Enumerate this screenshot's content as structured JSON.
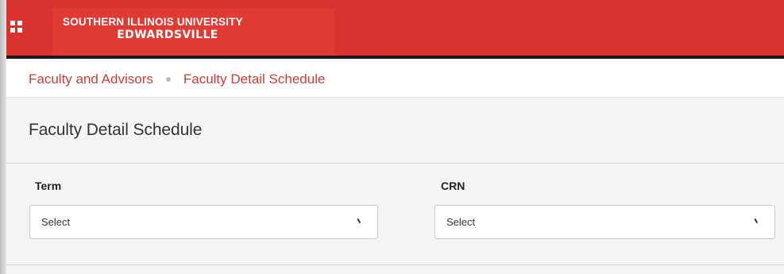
{
  "header": {
    "brand_line1": "SOUTHERN ILLINOIS UNIVERSITY",
    "brand_line2": "EDWARDSVILLE",
    "color": "#d9322f"
  },
  "breadcrumb": {
    "items": [
      "Faculty and Advisors",
      "Faculty Detail Schedule"
    ]
  },
  "page": {
    "title": "Faculty Detail Schedule"
  },
  "filters": {
    "term": {
      "label": "Term",
      "value": "Select"
    },
    "crn": {
      "label": "CRN",
      "value": "Select"
    }
  },
  "icons": [
    "apps-grid-icon",
    "chevron-down-icon"
  ]
}
